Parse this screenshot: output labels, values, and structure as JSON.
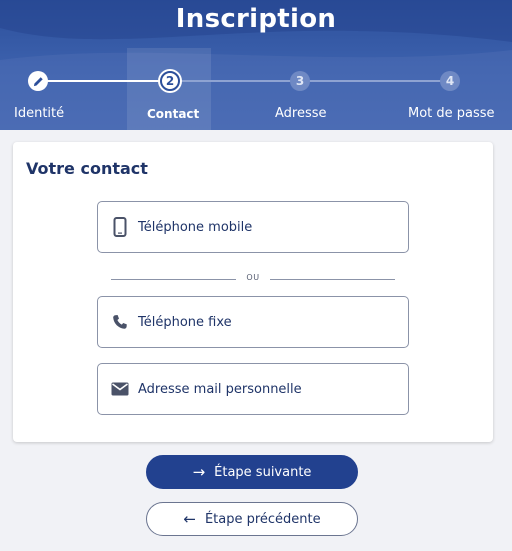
{
  "header": {
    "title": "Inscription"
  },
  "stepper": {
    "steps": [
      {
        "number": "",
        "label": "Identité",
        "state": "done",
        "icon": "pencil-icon"
      },
      {
        "number": "2",
        "label": "Contact",
        "state": "current"
      },
      {
        "number": "3",
        "label": "Adresse",
        "state": "todo"
      },
      {
        "number": "4",
        "label": "Mot de passe",
        "state": "todo"
      }
    ]
  },
  "card": {
    "title": "Votre contact",
    "options": [
      {
        "label": "Téléphone mobile",
        "icon": "mobile-phone-icon"
      },
      {
        "label": "Téléphone fixe",
        "icon": "phone-icon"
      },
      {
        "label": "Adresse mail personnelle",
        "icon": "mail-icon"
      }
    ],
    "divider_text": "OU"
  },
  "actions": {
    "next_label": "Étape suivante",
    "prev_label": "Étape précédente"
  },
  "colors": {
    "brand": "#2c4f9b",
    "primary_button": "#22418f",
    "text_dark": "#1f3468"
  }
}
